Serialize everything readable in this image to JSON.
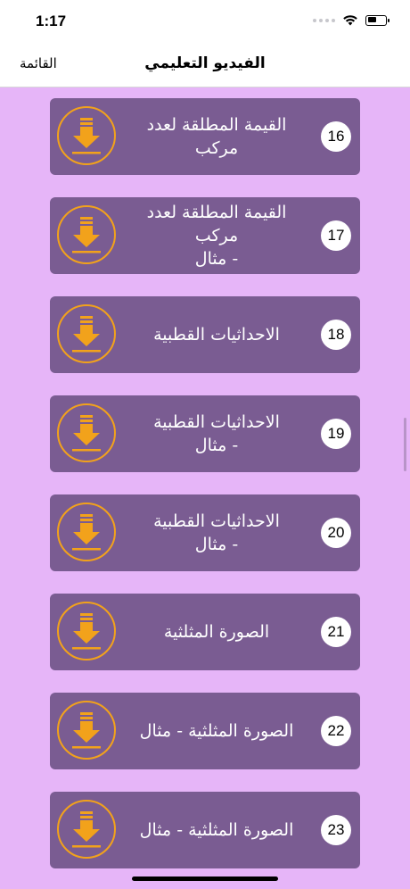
{
  "status_bar": {
    "time": "1:17"
  },
  "nav": {
    "title": "الفيديو التعليمي",
    "menu_label": "القائمة"
  },
  "colors": {
    "background": "#E6B5F8",
    "card": "#7A5C92",
    "download_accent": "#F2A21B"
  },
  "items": [
    {
      "number": "16",
      "title": "القيمة المطلقة لعدد مركب"
    },
    {
      "number": "17",
      "title": "القيمة المطلقة لعدد مركب\n- مثال"
    },
    {
      "number": "18",
      "title": "الاحداثيات القطبية"
    },
    {
      "number": "19",
      "title": "الاحداثيات القطبية\n- مثال"
    },
    {
      "number": "20",
      "title": "الاحداثيات القطبية\n- مثال"
    },
    {
      "number": "21",
      "title": "الصورة المثلثية"
    },
    {
      "number": "22",
      "title": "الصورة المثلثية - مثال"
    },
    {
      "number": "23",
      "title": "الصورة المثلثية - مثال"
    }
  ],
  "icons": {
    "download": "download-icon",
    "wifi": "wifi-icon",
    "battery": "battery-icon"
  }
}
